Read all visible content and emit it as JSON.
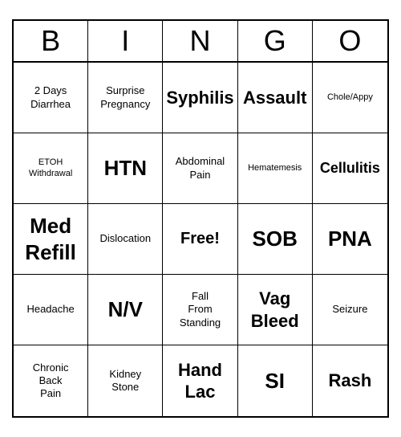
{
  "header": {
    "letters": [
      "B",
      "I",
      "N",
      "G",
      "O"
    ]
  },
  "cells": [
    {
      "text": "2 Days\nDiarrhea",
      "size": "normal"
    },
    {
      "text": "Surprise\nPregnancy",
      "size": "normal"
    },
    {
      "text": "Syphilis",
      "size": "large"
    },
    {
      "text": "Assault",
      "size": "large"
    },
    {
      "text": "Chole/Appy",
      "size": "small"
    },
    {
      "text": "ETOH\nWithdrawal",
      "size": "small"
    },
    {
      "text": "HTN",
      "size": "xlarge"
    },
    {
      "text": "Abdominal\nPain",
      "size": "normal"
    },
    {
      "text": "Hematemesis",
      "size": "small"
    },
    {
      "text": "Cellulitis",
      "size": "medium"
    },
    {
      "text": "Med\nRefill",
      "size": "xlarge"
    },
    {
      "text": "Dislocation",
      "size": "normal"
    },
    {
      "text": "Free!",
      "size": "free"
    },
    {
      "text": "SOB",
      "size": "xlarge"
    },
    {
      "text": "PNA",
      "size": "xlarge"
    },
    {
      "text": "Headache",
      "size": "normal"
    },
    {
      "text": "N/V",
      "size": "xlarge"
    },
    {
      "text": "Fall\nFrom\nStanding",
      "size": "normal"
    },
    {
      "text": "Vag\nBleed",
      "size": "large"
    },
    {
      "text": "Seizure",
      "size": "normal"
    },
    {
      "text": "Chronic\nBack\nPain",
      "size": "normal"
    },
    {
      "text": "Kidney\nStone",
      "size": "normal"
    },
    {
      "text": "Hand\nLac",
      "size": "large"
    },
    {
      "text": "SI",
      "size": "xlarge"
    },
    {
      "text": "Rash",
      "size": "large"
    }
  ]
}
